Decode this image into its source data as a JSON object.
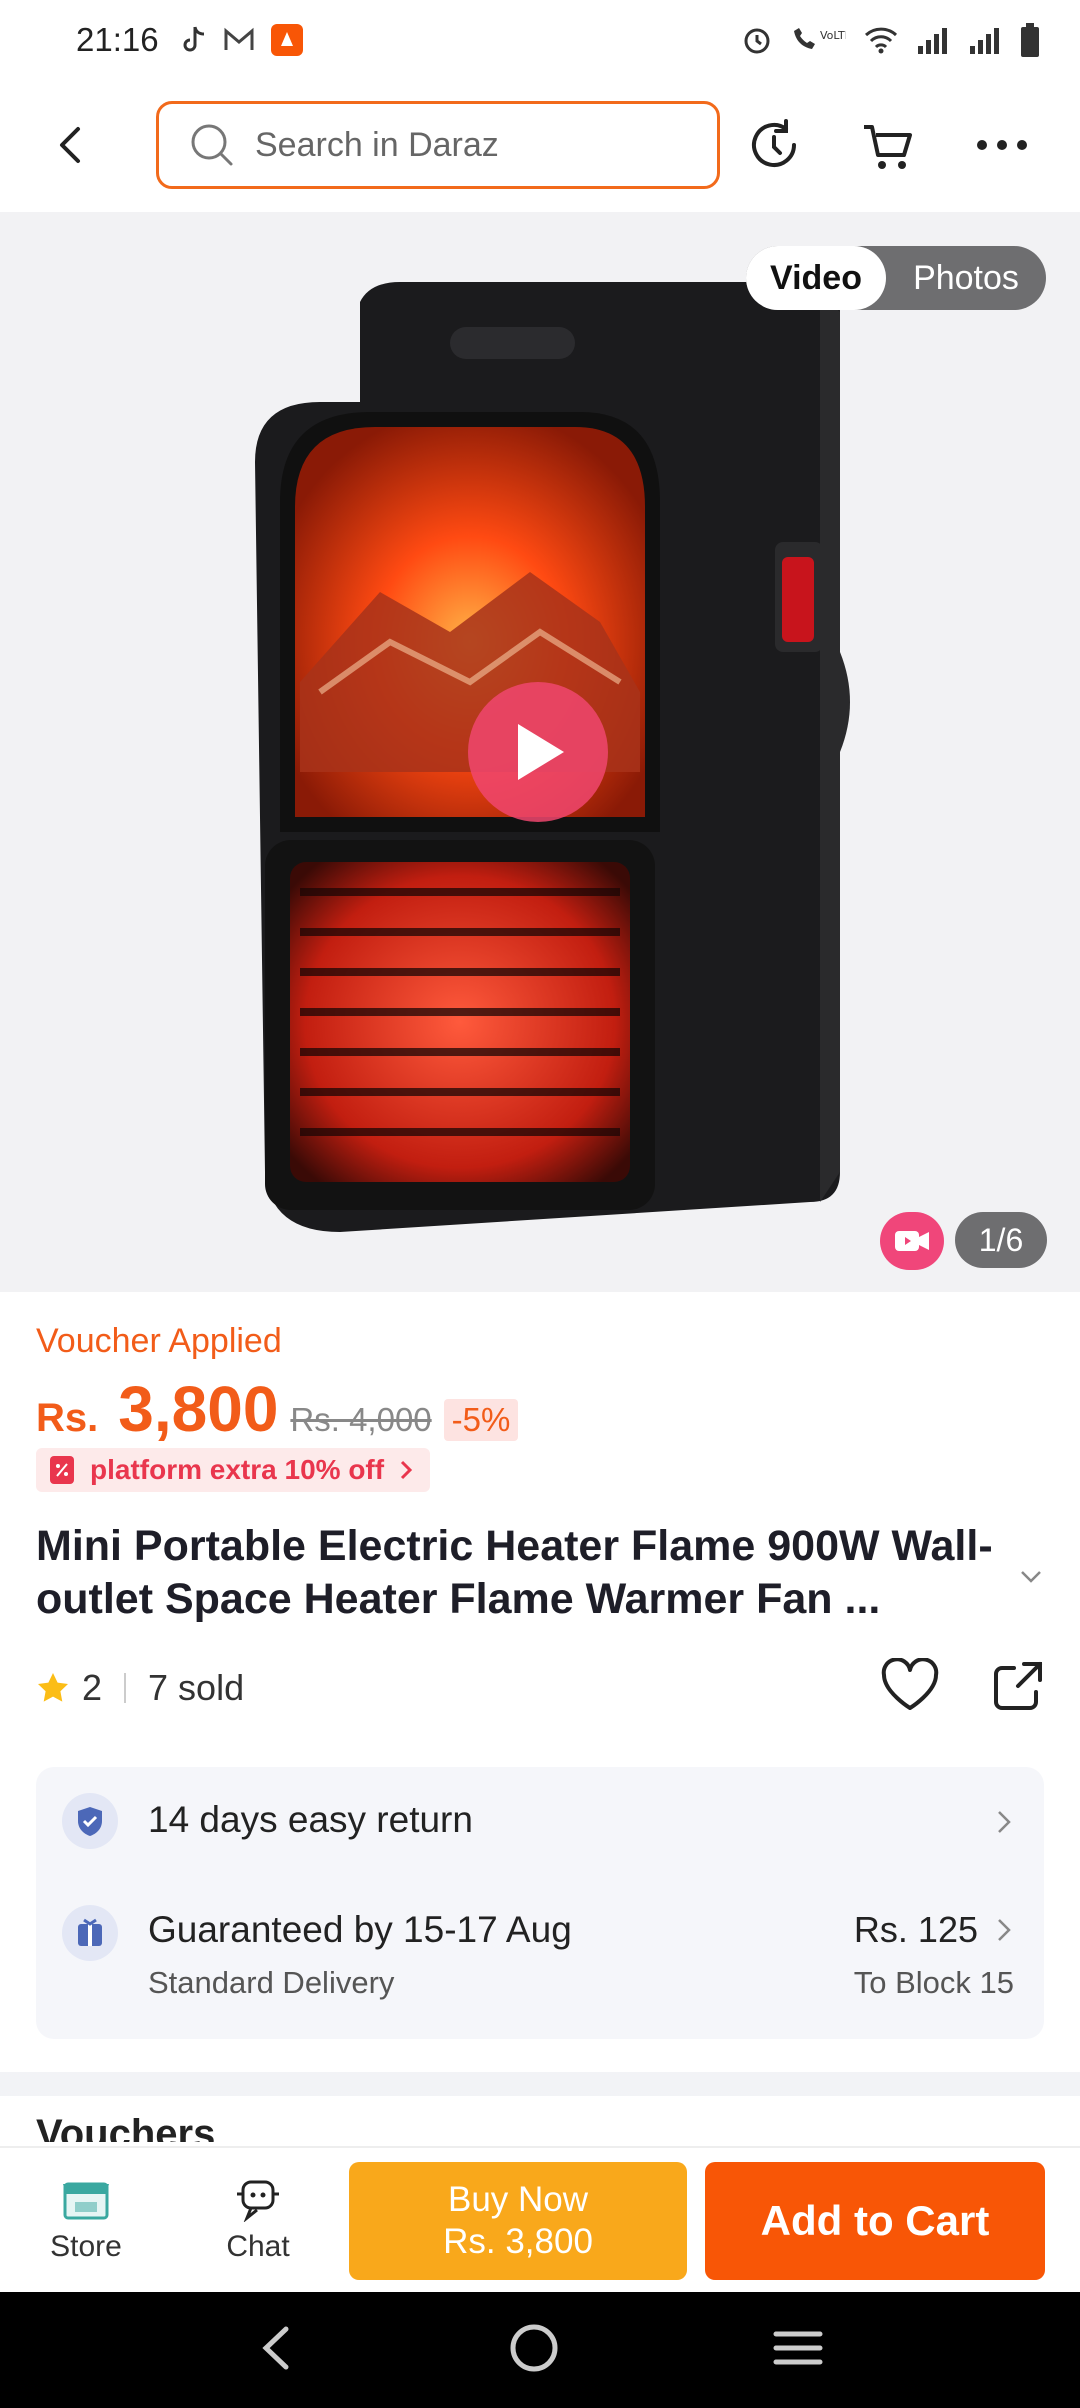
{
  "status_bar": {
    "time": "21:16"
  },
  "search": {
    "placeholder": "Search in Daraz"
  },
  "gallery": {
    "tab_video": "Video",
    "tab_photos": "Photos",
    "counter": "1/6"
  },
  "product": {
    "voucher_label": "Voucher Applied",
    "currency": "Rs.",
    "price": "3,800",
    "old_price": "Rs. 4,000",
    "discount": "-5%",
    "promo": "platform extra 10% off",
    "title": "Mini Portable Electric Heater Flame 900W Wall-outlet Space Heater Flame Warmer Fan ...",
    "rating": "2",
    "sold": "7 sold"
  },
  "services": {
    "return_text": "14 days easy return",
    "delivery_guarantee": "Guaranteed by 15-17 Aug",
    "delivery_type": "Standard Delivery",
    "delivery_fee": "Rs. 125",
    "delivery_destination": "To Block 15"
  },
  "section_peek": "Vouchers",
  "bottom_bar": {
    "store_label": "Store",
    "chat_label": "Chat",
    "buy_now_label": "Buy Now",
    "buy_now_price": "Rs. 3,800",
    "add_to_cart_label": "Add to Cart"
  },
  "colors": {
    "accent": "#f85606",
    "price": "#f25c19",
    "buy_now": "#f9a81b"
  }
}
